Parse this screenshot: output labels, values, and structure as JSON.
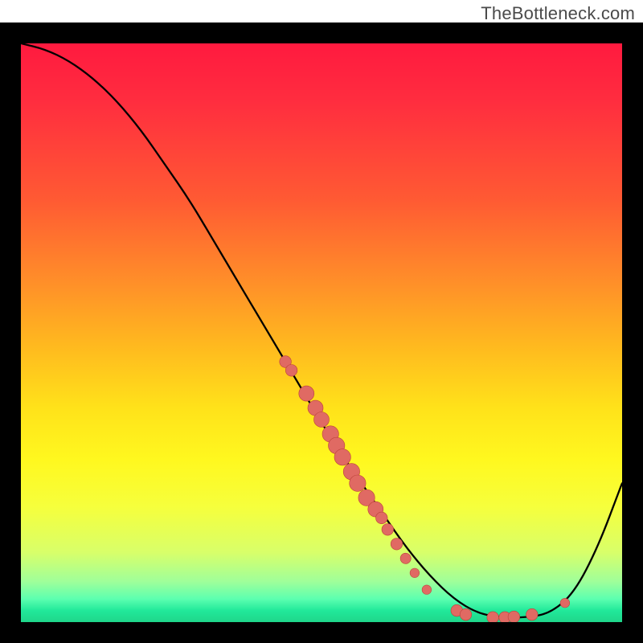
{
  "watermark": "TheBottleneck.com",
  "colors": {
    "frame": "#000000",
    "curve": "#000000",
    "marker_fill": "#e06a63",
    "marker_stroke": "#bb423a"
  },
  "chart_data": {
    "type": "line",
    "title": "",
    "xlabel": "",
    "ylabel": "",
    "xlim": [
      0,
      100
    ],
    "ylim": [
      0,
      100
    ],
    "grid": false,
    "curve": {
      "comment": "y=0 is top, y=100 is bottom (values given as plotted lower=closer to bottom valley)",
      "x": [
        0,
        4,
        8,
        12,
        16,
        20,
        24,
        28,
        32,
        36,
        40,
        44,
        48,
        52,
        56,
        60,
        64,
        68,
        72,
        76,
        80,
        84,
        88,
        92,
        96,
        100
      ],
      "y": [
        100,
        99,
        97,
        94,
        90,
        85,
        79,
        73,
        66,
        59,
        52,
        45,
        38,
        31,
        25,
        19,
        13,
        8,
        4,
        1.5,
        0.8,
        0.8,
        1.5,
        5,
        13,
        24
      ]
    },
    "markers": {
      "comment": "red dots along the curve; size in relative units",
      "points": [
        {
          "x": 44.0,
          "y": 45.0,
          "r": 1.0
        },
        {
          "x": 45.0,
          "y": 43.5,
          "r": 1.0
        },
        {
          "x": 47.5,
          "y": 39.5,
          "r": 1.3
        },
        {
          "x": 49.0,
          "y": 37.0,
          "r": 1.3
        },
        {
          "x": 50.0,
          "y": 35.0,
          "r": 1.3
        },
        {
          "x": 51.5,
          "y": 32.5,
          "r": 1.4
        },
        {
          "x": 52.5,
          "y": 30.5,
          "r": 1.4
        },
        {
          "x": 53.5,
          "y": 28.5,
          "r": 1.4
        },
        {
          "x": 55.0,
          "y": 26.0,
          "r": 1.4
        },
        {
          "x": 56.0,
          "y": 24.0,
          "r": 1.4
        },
        {
          "x": 57.5,
          "y": 21.5,
          "r": 1.4
        },
        {
          "x": 59.0,
          "y": 19.5,
          "r": 1.3
        },
        {
          "x": 60.0,
          "y": 18.0,
          "r": 1.0
        },
        {
          "x": 61.0,
          "y": 16.0,
          "r": 1.0
        },
        {
          "x": 62.5,
          "y": 13.5,
          "r": 1.0
        },
        {
          "x": 64.0,
          "y": 11.0,
          "r": 0.9
        },
        {
          "x": 65.5,
          "y": 8.5,
          "r": 0.8
        },
        {
          "x": 67.5,
          "y": 5.6,
          "r": 0.8
        },
        {
          "x": 72.5,
          "y": 2.0,
          "r": 1.0
        },
        {
          "x": 74.0,
          "y": 1.3,
          "r": 1.0
        },
        {
          "x": 78.5,
          "y": 0.8,
          "r": 1.0
        },
        {
          "x": 80.5,
          "y": 0.8,
          "r": 1.0
        },
        {
          "x": 82.0,
          "y": 0.9,
          "r": 1.0
        },
        {
          "x": 85.0,
          "y": 1.3,
          "r": 1.0
        },
        {
          "x": 90.5,
          "y": 3.3,
          "r": 0.8
        }
      ]
    }
  }
}
